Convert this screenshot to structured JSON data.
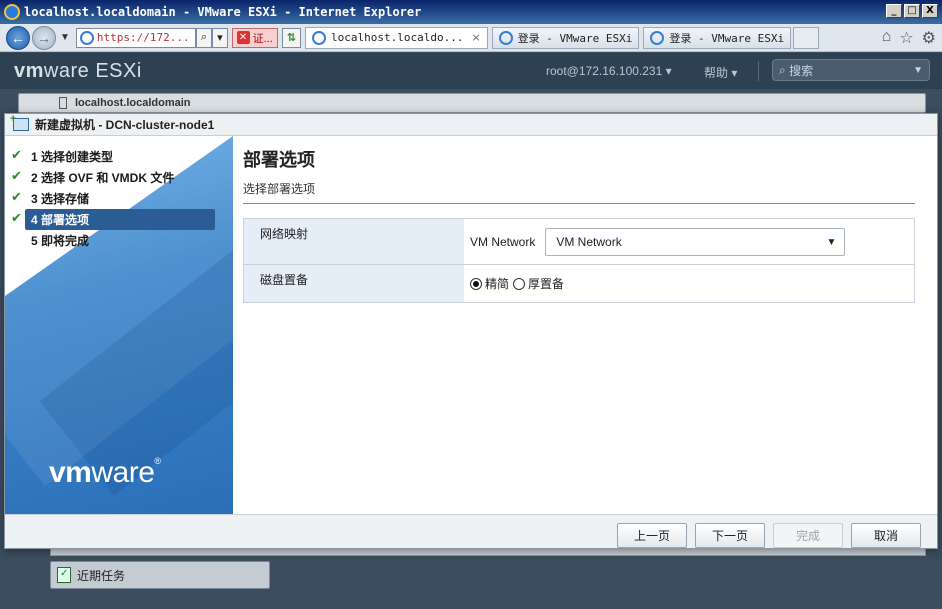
{
  "window": {
    "title": "localhost.localdomain - VMware ESXi - Internet Explorer",
    "min_label": "_",
    "max_label": "□",
    "close_label": "X"
  },
  "browser": {
    "address_text": "https://172...",
    "cert_label": "证...",
    "tabs": [
      {
        "label": "localhost.localdo...",
        "close": "×"
      },
      {
        "label": "登录 - VMware ESXi"
      },
      {
        "label": "登录 - VMware ESXi"
      }
    ],
    "right_icons": {
      "home": "⌂",
      "star": "☆",
      "gear": "⚙"
    }
  },
  "esxi": {
    "brand_vm": "vm",
    "brand_ware": "ware",
    "brand_product": "ESXi",
    "user": "root@172.16.100.231 ▾",
    "help": "帮助 ▾",
    "search_placeholder": "搜索",
    "host_name": "localhost.localdomain",
    "recent_tasks": "近期任务"
  },
  "dialog": {
    "title": "新建虚拟机 - DCN-cluster-node1",
    "steps": [
      {
        "label": "1 选择创建类型",
        "done": true
      },
      {
        "label": "2 选择 OVF 和 VMDK 文件",
        "done": true
      },
      {
        "label": "3 选择存储",
        "done": true
      },
      {
        "label": "4 部署选项",
        "done": true,
        "active": true
      },
      {
        "label": "5 即将完成",
        "done": false
      }
    ],
    "check_glyph": "✔",
    "logo_vm": "vm",
    "logo_ware": "ware",
    "logo_reg": "®",
    "heading": "部署选项",
    "subheading": "选择部署选项",
    "network_label": "网络映射",
    "network_source": "VM Network",
    "network_selected": "VM Network",
    "disk_label": "磁盘置备",
    "disk_option_thin": "精简",
    "disk_option_thick": "厚置备",
    "disk_selected": "thin",
    "buttons": {
      "back": "上一页",
      "next": "下一页",
      "finish": "完成",
      "cancel": "取消"
    }
  }
}
